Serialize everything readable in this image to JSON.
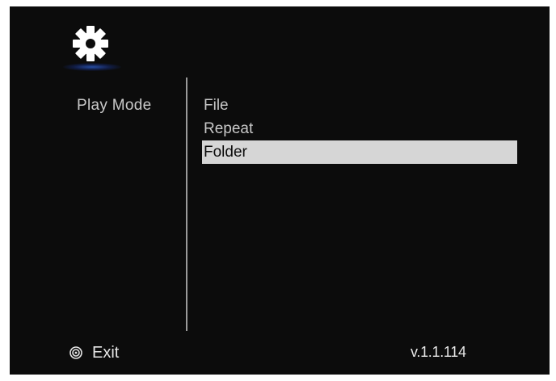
{
  "header": {
    "icon": "gear-icon"
  },
  "menu": {
    "label": "Play Mode",
    "options": [
      {
        "label": "File",
        "selected": false
      },
      {
        "label": "Repeat",
        "selected": false
      },
      {
        "label": "Folder",
        "selected": true
      }
    ]
  },
  "footer": {
    "exit_icon": "ok-button-icon",
    "exit_label": "Exit",
    "version": "v.1.1.114"
  },
  "colors": {
    "background": "#0c0c0c",
    "highlight": "#d6d6d6",
    "text": "#c9c9c9",
    "glow": "#2850aa"
  }
}
